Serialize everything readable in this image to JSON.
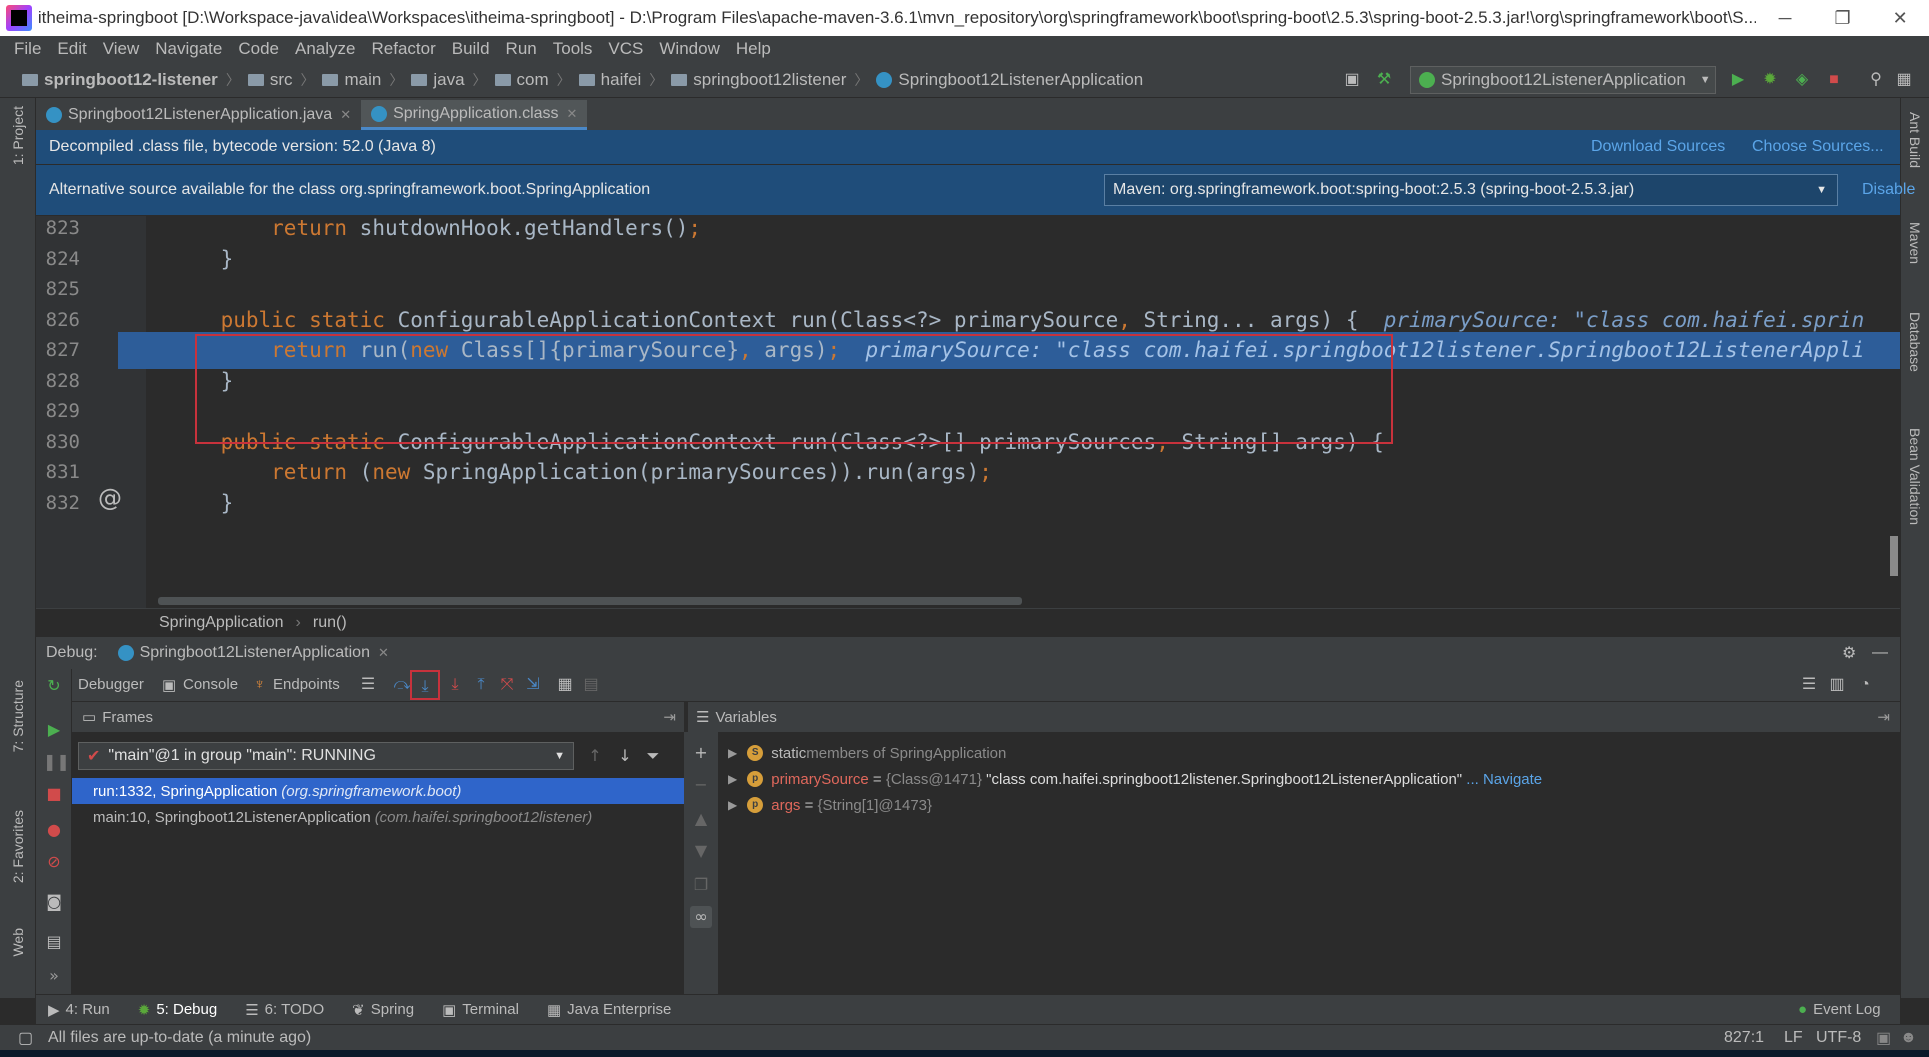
{
  "window": {
    "title": "itheima-springboot [D:\\Workspace-java\\idea\\Workspaces\\itheima-springboot] - D:\\Program Files\\apache-maven-3.6.1\\mvn_repository\\org\\springframework\\boot\\spring-boot\\2.5.3\\spring-boot-2.5.3.jar!\\org\\springframework\\boot\\S...",
    "minimize": "─",
    "restore": "❐",
    "close": "✕"
  },
  "menu": [
    "File",
    "Edit",
    "View",
    "Navigate",
    "Code",
    "Analyze",
    "Refactor",
    "Build",
    "Run",
    "Tools",
    "VCS",
    "Window",
    "Help"
  ],
  "breadcrumb": {
    "project": "springboot12-listener",
    "items": [
      "src",
      "main",
      "java",
      "com",
      "haifei",
      "springboot12listener"
    ],
    "class": "Springboot12ListenerApplication"
  },
  "run_config": "Springboot12ListenerApplication",
  "editor_tabs": [
    {
      "label": "Springboot12ListenerApplication.java",
      "active": false
    },
    {
      "label": "SpringApplication.class",
      "active": true
    }
  ],
  "banner_decompiled": {
    "text": "Decompiled .class file, bytecode version: 52.0 (Java 8)",
    "download_sources": "Download Sources",
    "choose_sources": "Choose Sources..."
  },
  "banner_alt_source": {
    "text": "Alternative source available for the class org.springframework.boot.SpringApplication",
    "maven_option": "Maven: org.springframework.boot:spring-boot:2.5.3 (spring-boot-2.5.3.jar)",
    "disable": "Disable"
  },
  "code": [
    {
      "ln": "823",
      "indent": "        ",
      "parts": [
        [
          "kw",
          "return "
        ],
        [
          "fn",
          "shutdownHook.getHandlers()"
        ],
        [
          "kw",
          ";"
        ]
      ],
      "hint": ""
    },
    {
      "ln": "824",
      "indent": "    ",
      "parts": [
        [
          "fn",
          "}"
        ]
      ],
      "hint": ""
    },
    {
      "ln": "825",
      "indent": "",
      "parts": [],
      "hint": ""
    },
    {
      "ln": "826",
      "indent": "    ",
      "parts": [
        [
          "kw",
          "public static "
        ],
        [
          "fn",
          "ConfigurableApplicationContext run(Class<?> primarySource"
        ],
        [
          "kw",
          ", "
        ],
        [
          "fn",
          "String... args) {"
        ]
      ],
      "hint": "  primarySource: \"class com.haifei.sprin"
    },
    {
      "ln": "827",
      "indent": "        ",
      "parts": [
        [
          "kw",
          "return "
        ],
        [
          "fn",
          "run("
        ],
        [
          "kw",
          "new "
        ],
        [
          "fn",
          "Class[]{primarySource}"
        ],
        [
          "kw",
          ", "
        ],
        [
          "fn",
          "args)"
        ],
        [
          "kw",
          ";"
        ]
      ],
      "hint": "  primarySource: \"class com.haifei.springboot12listener.Springboot12ListenerAppli"
    },
    {
      "ln": "828",
      "indent": "    ",
      "parts": [
        [
          "fn",
          "}"
        ]
      ],
      "hint": ""
    },
    {
      "ln": "829",
      "indent": "",
      "parts": [],
      "hint": ""
    },
    {
      "ln": "830",
      "indent": "    ",
      "parts": [
        [
          "kw",
          "public static "
        ],
        [
          "fn",
          "ConfigurableApplicationContext run(Class<?>[] primarySources"
        ],
        [
          "kw",
          ", "
        ],
        [
          "fn",
          "String[] args) {"
        ]
      ],
      "hint": ""
    },
    {
      "ln": "831",
      "indent": "        ",
      "parts": [
        [
          "kw",
          "return "
        ],
        [
          "fn",
          "("
        ],
        [
          "kw",
          "new "
        ],
        [
          "fn",
          "SpringApplication(primarySources)).run(args)"
        ],
        [
          "kw",
          ";"
        ]
      ],
      "hint": ""
    },
    {
      "ln": "832",
      "indent": "    ",
      "parts": [
        [
          "fn",
          "}"
        ]
      ],
      "hint": ""
    }
  ],
  "highlighted_line": "827",
  "editor_breadcrumb": [
    "SpringApplication",
    "run()"
  ],
  "debug": {
    "label": "Debug:",
    "session": "Springboot12ListenerApplication",
    "tabs": [
      "Debugger",
      "Console",
      "Endpoints"
    ],
    "frames_title": "Frames",
    "variables_title": "Variables",
    "thread": "\"main\"@1 in group \"main\": RUNNING",
    "frames": [
      {
        "method": "run:1332, SpringApplication",
        "pkg": "(org.springframework.boot)",
        "selected": true
      },
      {
        "method": "main:10, Springboot12ListenerApplication",
        "pkg": "(com.haifei.springboot12listener)",
        "selected": false
      }
    ],
    "variables": [
      {
        "badge": "S",
        "name": "static",
        "rest": " members of SpringApplication",
        "type": "",
        "value": "",
        "link": ""
      },
      {
        "badge": "p",
        "name": "primarySource",
        "rest": " = ",
        "type": "{Class@1471} ",
        "value": "\"class com.haifei.springboot12listener.Springboot12ListenerApplication\"",
        "link": " ... Navigate"
      },
      {
        "badge": "p",
        "name": "args",
        "rest": " = ",
        "type": "{String[1]@1473}",
        "value": "",
        "link": ""
      }
    ]
  },
  "left_tools": [
    "1: Project",
    "7: Structure",
    "2: Favorites",
    "Web"
  ],
  "right_tools": [
    "Ant Build",
    "Maven",
    "Database",
    "Bean Validation"
  ],
  "bottom_tabs": [
    "4: Run",
    "5: Debug",
    "6: TODO",
    "Spring",
    "Terminal",
    "Java Enterprise"
  ],
  "event_log": "Event Log",
  "status": {
    "message": "All files are up-to-date (a minute ago)",
    "position": "827:1",
    "line_sep": "LF",
    "encoding": "UTF-8"
  },
  "colors": {
    "accent": "#2f65ca",
    "breakpoint_box": "#c8323c",
    "banner": "#1f4d7a"
  }
}
